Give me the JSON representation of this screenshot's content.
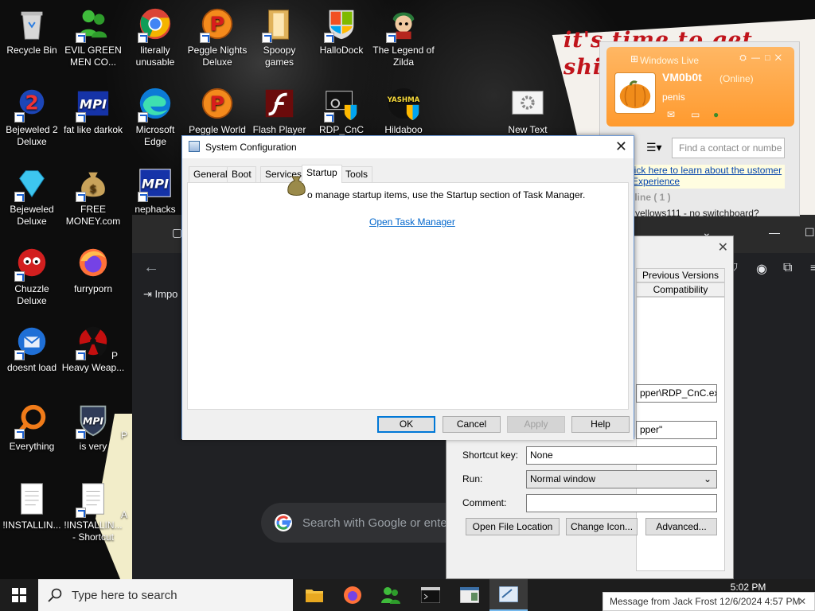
{
  "desktop": {
    "comic_text": "it's time to get shit and or t",
    "icons": [
      {
        "label": "Recycle Bin"
      },
      {
        "label": "EVIL GREEN MEN CO..."
      },
      {
        "label": "literally unusable"
      },
      {
        "label": "Peggle Nights Deluxe"
      },
      {
        "label": "Spoopy games"
      },
      {
        "label": "HalloDock"
      },
      {
        "label": "The Legend of Zilda"
      },
      {
        "label": "Bejeweled 2 Deluxe"
      },
      {
        "label": "fat like darkok"
      },
      {
        "label": "Microsoft Edge"
      },
      {
        "label": "Peggle World"
      },
      {
        "label": "Flash Player"
      },
      {
        "label": "RDP_CnC"
      },
      {
        "label": "Hildaboo"
      },
      {
        "label": "New Text"
      },
      {
        "label": "Bejeweled Deluxe"
      },
      {
        "label": "FREE MONEY.com"
      },
      {
        "label": "nephacks"
      },
      {
        "label": "Chuzzle Deluxe"
      },
      {
        "label": "furryporn"
      },
      {
        "label": "doesnt load"
      },
      {
        "label": "Heavy Weap..."
      },
      {
        "label": "Everything"
      },
      {
        "label": "is very"
      },
      {
        "label": "!INSTALLIN..."
      },
      {
        "label": "!INSTALLIN... - Shortcut"
      }
    ],
    "icon_labels_partial": {
      "p1": "P",
      "p2": "P",
      "p3": "A"
    },
    "icon_text": {
      "mpi": "MPI",
      "yashma": "YASHMA"
    }
  },
  "browser": {
    "import_label": "Impo",
    "search_placeholder": "Search with Google or ente"
  },
  "properties": {
    "tabs": [
      "Previous Versions",
      "Compatibility"
    ],
    "target_value": "pper\\RDP_CnC.exe\"",
    "start_in_value": "pper\"",
    "shortcut_key_label": "Shortcut key:",
    "shortcut_key_value": "None",
    "run_label": "Run:",
    "run_value": "Normal window",
    "comment_label": "Comment:",
    "comment_value": "",
    "buttons": [
      "Open File Location",
      "Change Icon...",
      "Advanced..."
    ]
  },
  "messenger": {
    "title": "Windows Live",
    "display_name": "VM0b0t",
    "status": "(Online)",
    "personal_message": "penis",
    "search_placeholder": "Find a contact or numbe",
    "ad_link": "lick here to learn about the ustomer Experience",
    "group_label": "nline ( 1 )",
    "contact": "yellows111 - no switchboard?"
  },
  "msconfig": {
    "title": "System Configuration",
    "tabs": [
      "General",
      "Boot",
      "Services",
      "Startup",
      "Tools"
    ],
    "active_tab": "Startup",
    "description": "o manage startup items, use the Startup section of Task Manager.",
    "link": "Open Task Manager",
    "buttons": {
      "ok": "OK",
      "cancel": "Cancel",
      "apply": "Apply",
      "help": "Help"
    }
  },
  "taskbar": {
    "search_placeholder": "Type here to search",
    "time": "5:02 PM"
  },
  "toast": {
    "text": "Message from Jack Frost 12/6/2024 4:57 PM"
  },
  "colors": {
    "accent": "#0078d7",
    "link": "#0066cc",
    "messenger_orange": "#ff9a2e",
    "comic_red": "#c0141b"
  }
}
